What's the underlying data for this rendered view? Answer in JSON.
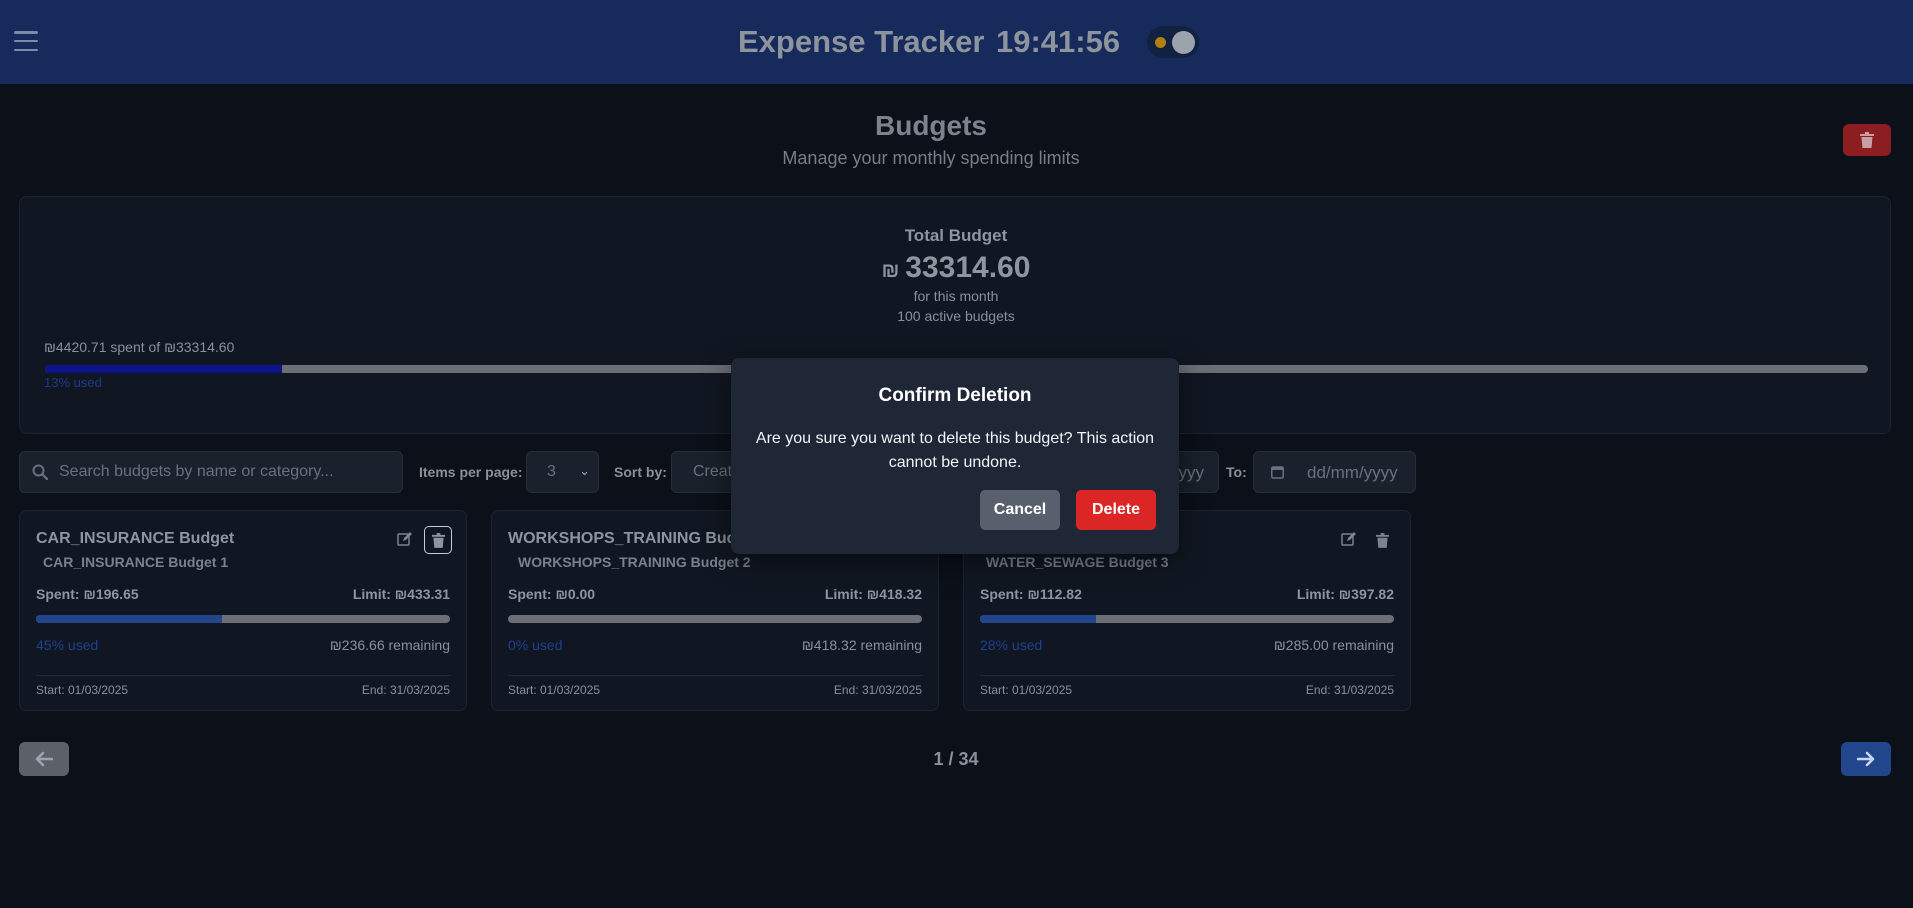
{
  "header": {
    "app_title": "Expense Tracker",
    "clock": "19:41:56",
    "colors": {
      "background": "#172a5c",
      "theme_toggle_dot": "#b07f12"
    }
  },
  "page": {
    "title": "Budgets",
    "subtitle": "Manage your monthly spending limits",
    "delete_all_icon": "trash-icon"
  },
  "summary": {
    "total_label": "Total Budget",
    "currency_symbol": "₪",
    "total_amount": "33314.60",
    "period_text": "for this month",
    "active_text": "100 active budgets",
    "spent_text": "₪4420.71 spent of ₪33314.60",
    "used_text": "13% used",
    "used_percent": 13
  },
  "filters": {
    "search_placeholder": "Search budgets by name or category...",
    "items_per_page_label": "Items per page:",
    "items_per_page_value": "3",
    "sort_by_label": "Sort by:",
    "sort_by_value": "Creat",
    "from_date_value": "yyyy",
    "to_label": "To:",
    "to_date_placeholder": "dd/mm/yyyy"
  },
  "budgets": [
    {
      "title": "CAR_INSURANCE Budget",
      "subtitle": "CAR_INSURANCE Budget 1",
      "spent": "Spent: ₪196.65",
      "limit": "Limit: ₪433.31",
      "used_text": "45% used",
      "used_percent": 45,
      "remaining": "₪236.66 remaining",
      "start": "Start: 01/03/2025",
      "end": "End: 31/03/2025"
    },
    {
      "title": "WORKSHOPS_TRAINING Budge",
      "subtitle": "WORKSHOPS_TRAINING Budget 2",
      "spent": "Spent: ₪0.00",
      "limit": "Limit: ₪418.32",
      "used_text": "0% used",
      "used_percent": 0,
      "remaining": "₪418.32 remaining",
      "start": "Start: 01/03/2025",
      "end": "End: 31/03/2025"
    },
    {
      "subtitle": "WATER_SEWAGE Budget 3",
      "spent": "Spent: ₪112.82",
      "limit": "Limit: ₪397.82",
      "used_text": "28% used",
      "used_percent": 28,
      "remaining": "₪285.00 remaining",
      "start": "Start: 01/03/2025",
      "end": "End: 31/03/2025"
    }
  ],
  "pagination": {
    "indicator": "1 / 34",
    "prev_icon": "arrow-left-icon",
    "next_icon": "arrow-right-icon"
  },
  "modal": {
    "title": "Confirm Deletion",
    "message": "Are you sure you want to delete this budget? This action cannot be undone.",
    "cancel_label": "Cancel",
    "delete_label": "Delete",
    "colors": {
      "delete": "#dc2626",
      "cancel": "#59606d"
    }
  }
}
